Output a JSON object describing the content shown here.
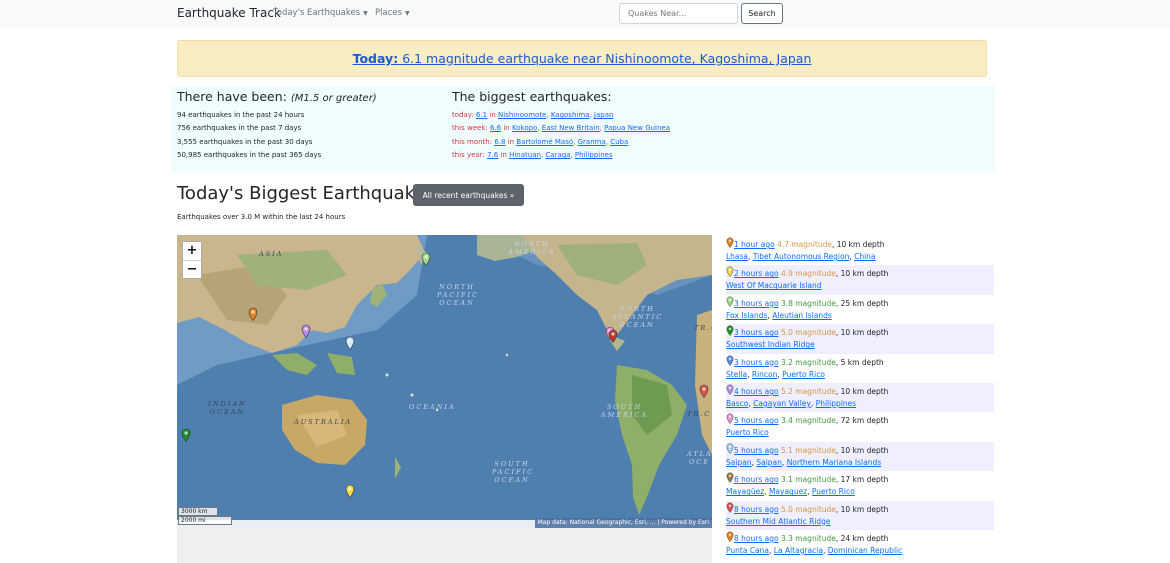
{
  "navbar": {
    "brand": "Earthquake Track",
    "menu_earthquakes": "Today's Earthquakes",
    "menu_places": "Places",
    "search_placeholder": "Quakes Near...",
    "search_button": "Search"
  },
  "alert": {
    "today_label": "Today:",
    "text": "6.1 magnitude earthquake near Nishinoomote, Kagoshima, Japan"
  },
  "stats": {
    "heading": "There have been:",
    "heading_note": "(M1.5 or greater)",
    "lines": [
      "94 earthquakes in the past 24 hours",
      "756 earthquakes in the past 7 days",
      "3,555 earthquakes in the past 30 days",
      "50,985 earthquakes in the past 365 days"
    ]
  },
  "biggest": {
    "heading": "The biggest earthquakes:",
    "rows": [
      {
        "period": "today:",
        "mag": "6.1",
        "in": "in",
        "places": [
          "Nishinoomote",
          "Kagoshima",
          "Japan"
        ]
      },
      {
        "period": "this week:",
        "mag": "6.6",
        "in": "in",
        "places": [
          "Kokopo",
          "East New Britain",
          "Papua New Guinea"
        ]
      },
      {
        "period": "this month:",
        "mag": "6.8",
        "in": "in",
        "places": [
          "Bartolomé Masó",
          "Granma",
          "Cuba"
        ]
      },
      {
        "period": "this year:",
        "mag": "7.6",
        "in": "in",
        "places": [
          "Hinatuan",
          "Caraga",
          "Philippines"
        ]
      }
    ]
  },
  "todays": {
    "heading": "Today's Biggest Earthquakes",
    "button": "All recent earthquakes »",
    "subtitle": "Earthquakes over 3.0 M within the last 24 hours"
  },
  "map": {
    "zoom_in": "+",
    "zoom_out": "−",
    "scale_km": "3000 km",
    "scale_mi": "2000 mi",
    "attribution": "Map data: National Geographic, Esri, ...  | Powered by Esri",
    "labels": {
      "asia": "ASIA",
      "north_america": "NORTH\nAMERICA",
      "north_pacific": "NORTH\nPACIFIC\nOCEAN",
      "north_atlantic": "NORTH\nATLANTIC\nOCEAN",
      "indian_ocean": "INDIAN\nOCEAN",
      "australia": "AUSTRALIA",
      "oceania": "OCEANIA",
      "south_america": "SOUTH\nAMERICA",
      "south_pacific": "SOUTH\nPACIFIC\nOCEAN",
      "south_atlantic": "ATLA\nOCE",
      "tropic_1": "TR.C",
      "tropic_2": "TR.C"
    },
    "markers": [
      {
        "name": "Lhasa",
        "color": "#e8821f"
      },
      {
        "name": "Fox Islands",
        "color": "#9fd98a"
      },
      {
        "name": "Saipan",
        "color": "#cfe7ff"
      },
      {
        "name": "Basco",
        "color": "#b98ce6"
      },
      {
        "name": "Puerto Rico",
        "color": "#ef8fd0"
      },
      {
        "name": "Mayaguez",
        "color": "#c0392b"
      },
      {
        "name": "Southern Mid Atlantic Ridge",
        "color": "#e05050"
      },
      {
        "name": "Southwest Indian Ridge",
        "color": "#1f8f2a"
      },
      {
        "name": "West Of Macquarie Island",
        "color": "#f2d84b"
      }
    ]
  },
  "recent": [
    {
      "time": "1 hour ago",
      "mag": "4.7",
      "depth": "10 km depth",
      "places": [
        "Lhasa",
        "Tibet Autonomous Region",
        "China"
      ],
      "pin": "#e8821f",
      "high": true
    },
    {
      "time": "2 hours ago",
      "mag": "4.9",
      "depth": "10 km depth",
      "places": [
        "West Of Macquarie Island"
      ],
      "pin": "#f2d84b",
      "high": true
    },
    {
      "time": "3 hours ago",
      "mag": "3.8",
      "depth": "25 km depth",
      "places": [
        "Fox Islands",
        "Aleutian Islands"
      ],
      "pin": "#9fd98a",
      "high": false
    },
    {
      "time": "3 hours ago",
      "mag": "5.0",
      "depth": "10 km depth",
      "places": [
        "Southwest Indian Ridge"
      ],
      "pin": "#1f8f2a",
      "high": true
    },
    {
      "time": "3 hours ago",
      "mag": "3.2",
      "depth": "5 km depth",
      "places": [
        "Stella",
        "Rincon",
        "Puerto Rico"
      ],
      "pin": "#5b8be6",
      "high": false
    },
    {
      "time": "4 hours ago",
      "mag": "5.2",
      "depth": "10 km depth",
      "places": [
        "Basco",
        "Cagayan Valley",
        "Philippines"
      ],
      "pin": "#b98ce6",
      "high": true
    },
    {
      "time": "5 hours ago",
      "mag": "3.4",
      "depth": "72 km depth",
      "places": [
        "Puerto Rico"
      ],
      "pin": "#ef8fd0",
      "high": false
    },
    {
      "time": "5 hours ago",
      "mag": "5.1",
      "depth": "10 km depth",
      "places": [
        "Saipan",
        "Saipan",
        "Northern Mariana Islands"
      ],
      "pin": "#a8d4f5",
      "high": true
    },
    {
      "time": "6 hours ago",
      "mag": "3.1",
      "depth": "17 km depth",
      "places": [
        "Mayagüez",
        "Mayaguez",
        "Puerto Rico"
      ],
      "pin": "#9c7a4c",
      "high": false
    },
    {
      "time": "8 hours ago",
      "mag": "5.0",
      "depth": "10 km depth",
      "places": [
        "Southern Mid Atlantic Ridge"
      ],
      "pin": "#e05050",
      "high": true
    },
    {
      "time": "8 hours ago",
      "mag": "3.3",
      "depth": "24 km depth",
      "places": [
        "Punta Cana",
        "La Altagracia",
        "Dominican Republic"
      ],
      "pin": "#e8821f",
      "high": false
    }
  ],
  "labels": {
    "magnitude_word": "magnitude",
    "comma": ","
  }
}
